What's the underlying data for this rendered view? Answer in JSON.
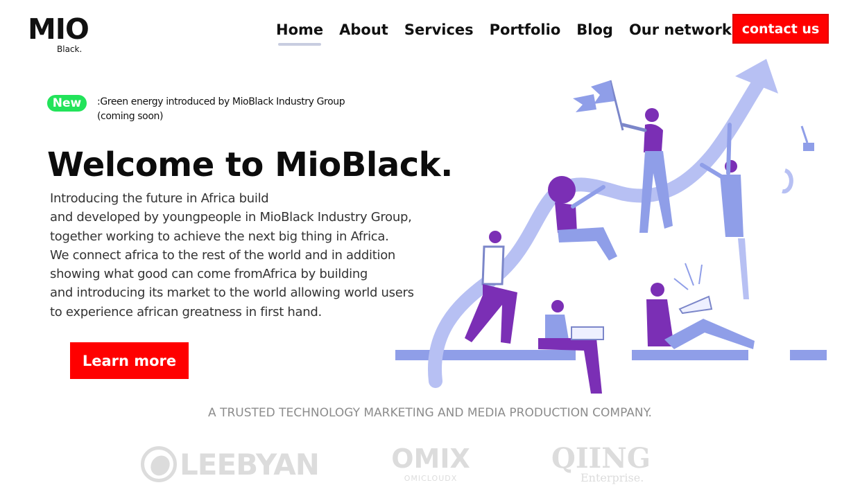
{
  "header": {
    "logo_main": "MIO",
    "logo_sub": "Black.",
    "nav": [
      {
        "label": "Home",
        "active": true
      },
      {
        "label": "About"
      },
      {
        "label": "Services"
      },
      {
        "label": "Portfolio"
      },
      {
        "label": "Blog"
      },
      {
        "label": "Our network"
      }
    ],
    "contact_label": "contact us"
  },
  "announcement": {
    "badge": "New",
    "line1": ":Green energy introduced by MioBlack Industry Group",
    "line2": "(coming soon)"
  },
  "hero": {
    "title": "Welcome to MioBlack.",
    "lines": [
      "Introducing the future in Africa build",
      "and developed by youngpeople in MioBlack Industry Group,",
      "together working to achieve the next  big thing in Africa.",
      "We connect africa to the rest of the world and in addition",
      "showing what good can come fromAfrica by building",
      "and introducing its market to the world allowing world users",
      "to experience african greatness in first hand."
    ],
    "cta_label": "Learn more"
  },
  "trusted_text": "A TRUSTED TECHNOLOGY  MARKETING AND MEDIA PRODUCTION COMPANY.",
  "partners": {
    "leebyan": "LEEBYAN",
    "omix": "OMIX",
    "omix_sub": "OMICLOUDX",
    "qiing": "QIING",
    "qiing_sub": "Enterprise."
  },
  "colors": {
    "accent_red": "#ff0000",
    "badge_green": "#22e35a",
    "illustration_purple": "#7b2fb5",
    "illustration_blue": "#8f9ee8"
  }
}
